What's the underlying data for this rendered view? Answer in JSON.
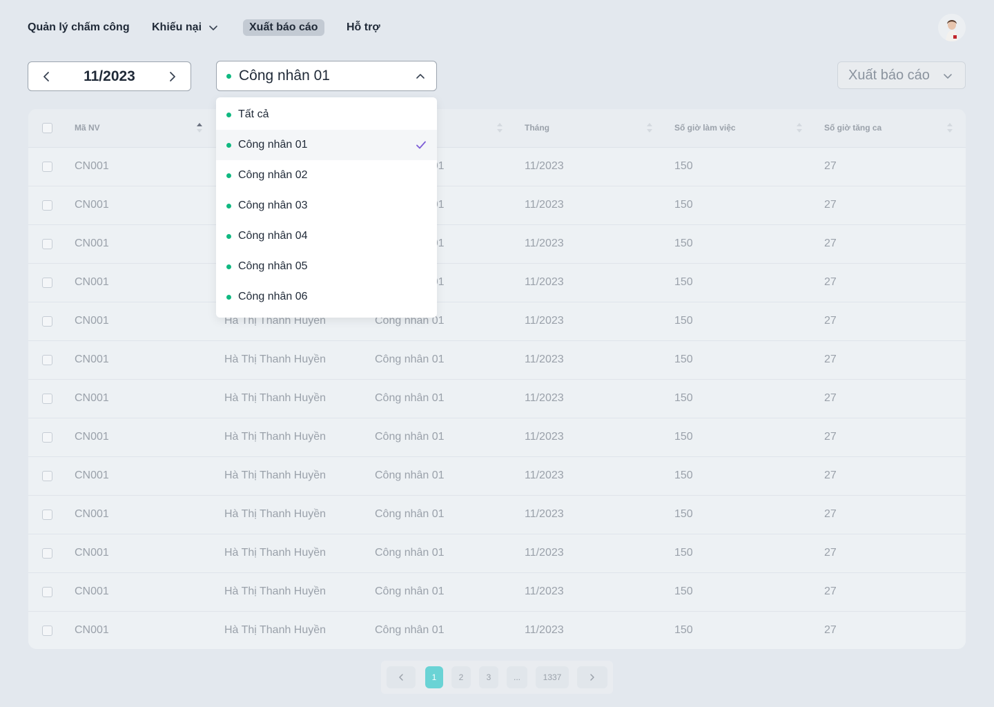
{
  "nav": {
    "items": [
      {
        "label": "Quản lý chấm công"
      },
      {
        "label": "Khiếu nại"
      },
      {
        "label": "Xuất báo cáo"
      },
      {
        "label": "Hỗ trợ"
      }
    ]
  },
  "filters": {
    "month": "11/2023",
    "worker_selected": "Công nhân 01",
    "worker_options": [
      "Tất cả",
      "Công nhân 01",
      "Công nhân 02",
      "Công nhân 03",
      "Công nhân 04",
      "Công nhân 05",
      "Công nhân 06"
    ],
    "export_label": "Xuất báo cáo"
  },
  "table": {
    "headers": [
      "Mã NV",
      "",
      "",
      "Tháng",
      "Số giờ làm việc",
      "Số giờ tăng ca"
    ],
    "rows": [
      [
        "CN001",
        "",
        "Công nhân 01",
        "11/2023",
        "150",
        "27"
      ],
      [
        "CN001",
        "",
        "Công nhân 01",
        "11/2023",
        "150",
        "27"
      ],
      [
        "CN001",
        "",
        "Công nhân 01",
        "11/2023",
        "150",
        "27"
      ],
      [
        "CN001",
        "",
        "Công nhân 01",
        "11/2023",
        "150",
        "27"
      ],
      [
        "CN001",
        "Hà Thị Thanh Huyền",
        "Công nhân 01",
        "11/2023",
        "150",
        "27"
      ],
      [
        "CN001",
        "Hà Thị Thanh Huyền",
        "Công nhân 01",
        "11/2023",
        "150",
        "27"
      ],
      [
        "CN001",
        "Hà Thị Thanh Huyền",
        "Công nhân 01",
        "11/2023",
        "150",
        "27"
      ],
      [
        "CN001",
        "Hà Thị Thanh Huyền",
        "Công nhân 01",
        "11/2023",
        "150",
        "27"
      ],
      [
        "CN001",
        "Hà Thị Thanh Huyền",
        "Công nhân 01",
        "11/2023",
        "150",
        "27"
      ],
      [
        "CN001",
        "Hà Thị Thanh Huyền",
        "Công nhân 01",
        "11/2023",
        "150",
        "27"
      ],
      [
        "CN001",
        "Hà Thị Thanh Huyền",
        "Công nhân 01",
        "11/2023",
        "150",
        "27"
      ],
      [
        "CN001",
        "Hà Thị Thanh Huyền",
        "Công nhân 01",
        "11/2023",
        "150",
        "27"
      ],
      [
        "CN001",
        "Hà Thị Thanh Huyền",
        "Công nhân 01",
        "11/2023",
        "150",
        "27"
      ]
    ]
  },
  "pagination": {
    "pages": [
      "1",
      "2",
      "3",
      "...",
      "1337"
    ],
    "current": "1"
  },
  "colors": {
    "status_dot": "#10b981",
    "accent_check": "#7c5cd6",
    "active_page": "#6ad3d5"
  }
}
